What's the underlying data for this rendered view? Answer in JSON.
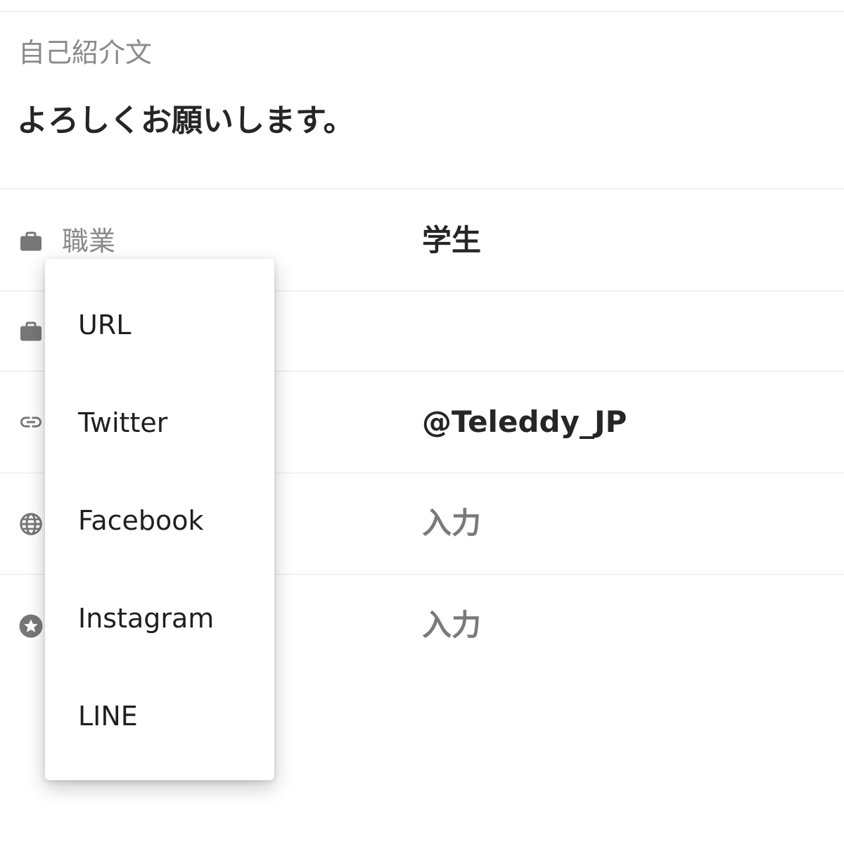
{
  "bio": {
    "label": "自己紹介文",
    "text": "よろしくお願いします。"
  },
  "profile_rows": [
    {
      "icon": "briefcase-icon",
      "label": "職業",
      "value": "学生"
    },
    {
      "icon": "briefcase-icon",
      "label": "",
      "value": ""
    },
    {
      "icon": "link-icon",
      "label": "",
      "value": "@Teleddy_JP"
    },
    {
      "icon": "globe-icon",
      "label": "",
      "value": "入力"
    },
    {
      "icon": "star-circle-icon",
      "label": "",
      "value": "入力"
    }
  ],
  "link_type_menu": {
    "options": [
      "URL",
      "Twitter",
      "Facebook",
      "Instagram",
      "LINE"
    ]
  },
  "colors": {
    "icon_gray": "#777777",
    "label_gray": "#8a8a8a",
    "text_dark": "#262626",
    "divider": "#e6e6e6"
  }
}
